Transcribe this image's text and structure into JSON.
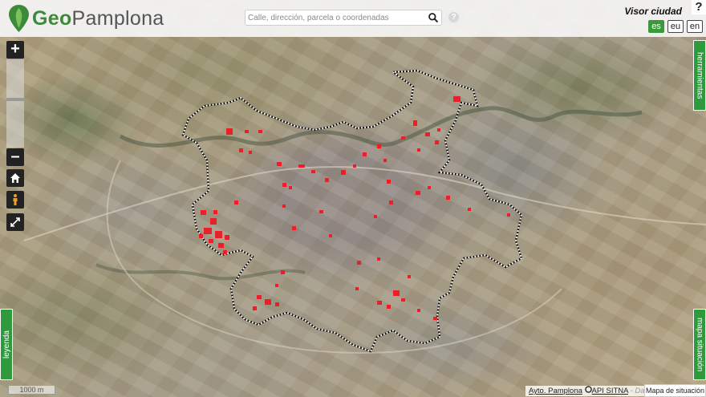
{
  "header": {
    "logo_bold": "Geo",
    "logo_rest": "Pamplona",
    "title": "Visor ciudad",
    "help": "?"
  },
  "search": {
    "placeholder": "Calle, dirección, parcela o coordenadas"
  },
  "languages": [
    {
      "code": "es",
      "active": true
    },
    {
      "code": "eu",
      "active": false
    },
    {
      "code": "en",
      "active": false
    }
  ],
  "controls": {
    "zoom_in": "+",
    "zoom_out": "–"
  },
  "tabs": {
    "herramientas": "herramientas",
    "leyenda": "leyenda",
    "mapa_situacion": "mapa situación"
  },
  "footer": {
    "scale": "1000 m",
    "attribution_link": "Ayto. Pamplona",
    "attribution_api": "API SITNA",
    "attribution_rest": "- Dat",
    "mapa_situacion_button": "Mapa de situación"
  },
  "colors": {
    "brand_green": "#3c8a3a",
    "tab_green": "#2d9a3c",
    "boundary": "#111111",
    "markers": "#e8202a"
  }
}
